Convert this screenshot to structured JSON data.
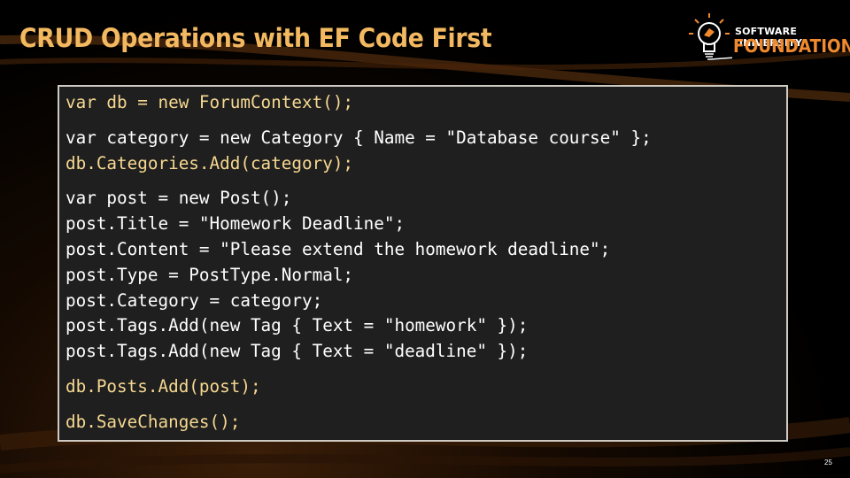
{
  "slide": {
    "title": "CRUD Operations with EF Code First",
    "page_number": "25"
  },
  "logo": {
    "line1": "SOFTWARE UNIVERSITY",
    "line2": "FOUNDATION",
    "icon": "lightbulb-icon"
  },
  "code": {
    "groups": [
      [
        {
          "text": "var db = new ForumContext();",
          "style": "y"
        }
      ],
      [
        {
          "text": "var category = new Category { Name = \"Database course\" };",
          "style": "w"
        },
        {
          "text": "db.Categories.Add(category);",
          "style": "y"
        }
      ],
      [
        {
          "text": "var post = new Post();",
          "style": "w"
        },
        {
          "text": "post.Title = \"Homework Deadline\";",
          "style": "w"
        },
        {
          "text": "post.Content = \"Please extend the homework deadline\";",
          "style": "w"
        },
        {
          "text": "post.Type = PostType.Normal;",
          "style": "w"
        },
        {
          "text": "post.Category = category;",
          "style": "w"
        },
        {
          "text": "post.Tags.Add(new Tag { Text = \"homework\" });",
          "style": "w"
        },
        {
          "text": "post.Tags.Add(new Tag { Text = \"deadline\" });",
          "style": "w"
        }
      ],
      [
        {
          "text": "db.Posts.Add(post);",
          "style": "y"
        }
      ],
      [
        {
          "text": "db.SaveChanges();",
          "style": "y"
        }
      ]
    ]
  },
  "colors": {
    "title": "#f3b961",
    "code_highlight": "#f6d891",
    "code_default": "#ffffff",
    "code_bg": "#1f1f1f",
    "brand_orange": "#f18a2e"
  }
}
